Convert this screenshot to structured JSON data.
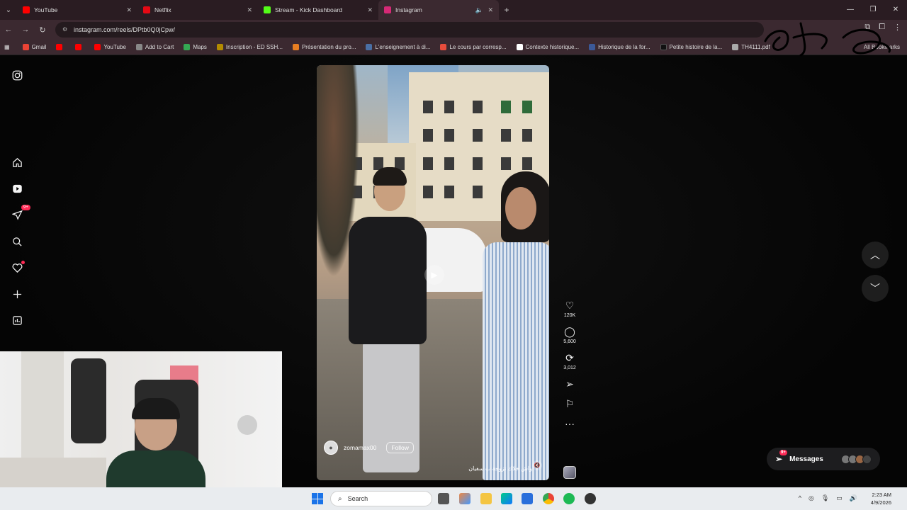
{
  "browser": {
    "tabs": [
      {
        "label": "YouTube",
        "color": "#ff0000"
      },
      {
        "label": "Netflix",
        "color": "#e50914"
      },
      {
        "label": "Stream - Kick Dashboard",
        "color": "#53fc18"
      },
      {
        "label": "Instagram",
        "color": "#d62976",
        "active": true
      }
    ],
    "url": "instagram.com/reels/DPtb0Q0jCpw/",
    "bookmarks": [
      {
        "label": "Gmail",
        "color": "#ea4335"
      },
      {
        "label": "",
        "color": "#ff0000"
      },
      {
        "label": "",
        "color": "#ff0000"
      },
      {
        "label": "YouTube",
        "color": "#ff0000"
      },
      {
        "label": "Add to Cart",
        "color": "#888888"
      },
      {
        "label": "Maps",
        "color": "#34a853"
      },
      {
        "label": "Inscription - ED SSH...",
        "color": "#b38b00"
      },
      {
        "label": "Présentation du pro...",
        "color": "#e67e22"
      },
      {
        "label": "L'enseignement à di...",
        "color": "#4a6fa5"
      },
      {
        "label": "Le cours par corresp...",
        "color": "#e74c3c"
      },
      {
        "label": "Contexte historique...",
        "color": "#ffffff"
      },
      {
        "label": "Historique de la for...",
        "color": "#3b5998"
      },
      {
        "label": "Petite histoire de la...",
        "color": "#111111"
      },
      {
        "label": "TH4111.pdf",
        "color": "#aaaaaa"
      }
    ],
    "all_bookmarks": "All Bookmarks"
  },
  "instagram": {
    "sidenav_badge": "9+",
    "reel": {
      "username": "zomamax00",
      "follow_label": "Follow",
      "caption": "واش خلاك تزوجة ب سفيان"
    },
    "actions": {
      "likes": "120K",
      "comments": "5,600",
      "reposts": "3,012"
    },
    "messages": {
      "label": "Messages",
      "badge": "9+"
    }
  },
  "taskbar": {
    "search_placeholder": "Search",
    "time": "2:23 AM",
    "date": "4/9/2026"
  }
}
